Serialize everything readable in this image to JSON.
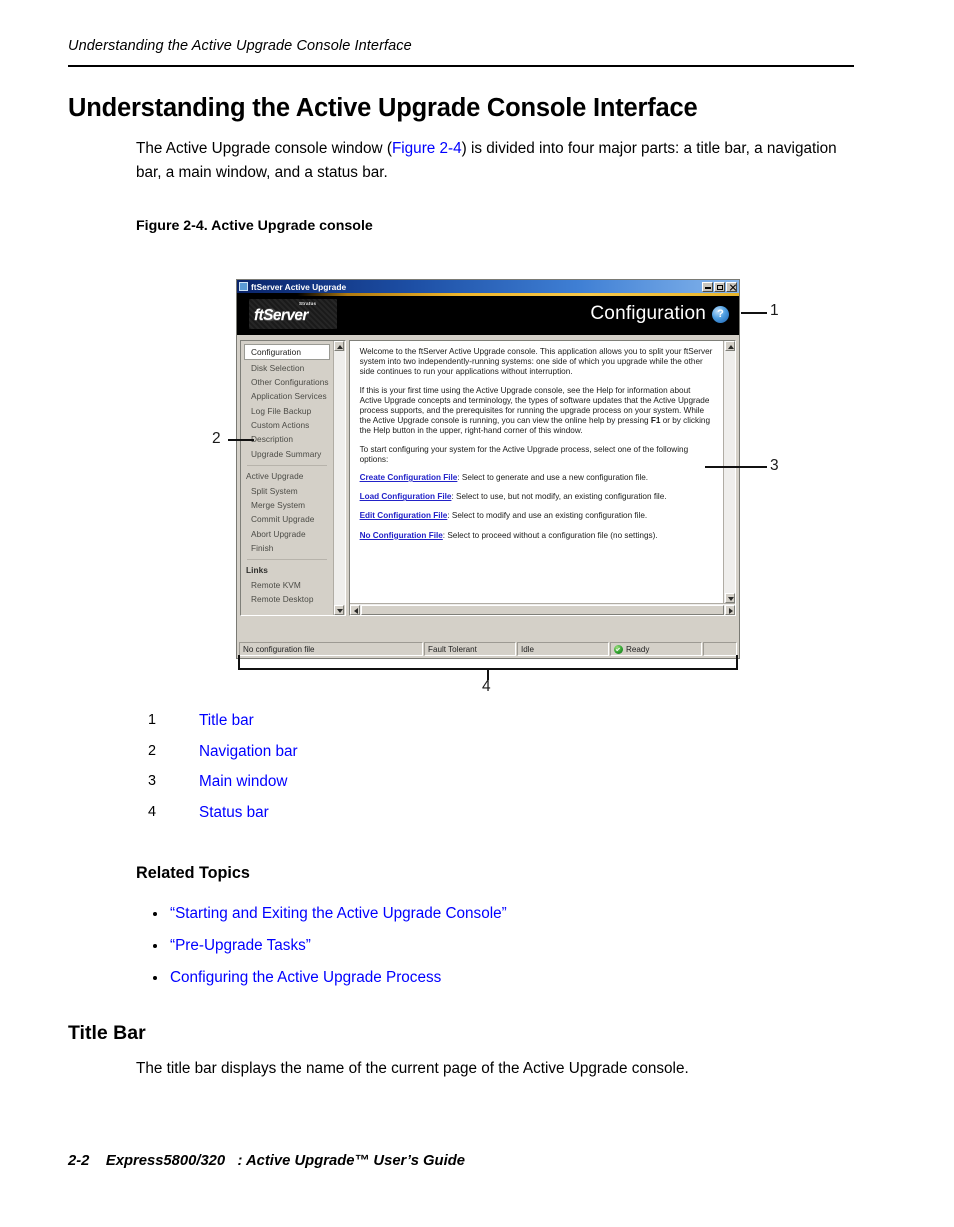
{
  "page": {
    "running_head": "Understanding the Active Upgrade Console Interface",
    "h1": "Understanding the Active Upgrade Console Interface",
    "intro_part1": "The Active Upgrade console window (",
    "intro_figure_link": "Figure 2-4",
    "intro_part2": ") is divided into four major parts: a title bar, a navigation bar, a main window, and a status bar.",
    "figure_caption": "Figure 2-4. Active Upgrade console",
    "related_heading": "Related Topics",
    "title_bar_heading": "Title Bar",
    "title_bar_para": "The title bar displays the name of the current page of the Active Upgrade console.",
    "footer_page": "2-2",
    "footer_text": "Express5800/320   : Active Upgrade™ User’s Guide",
    "link_color": "#0000ff"
  },
  "console": {
    "window_title": "ftServer Active Upgrade",
    "window_buttons": [
      "minimize",
      "maximize",
      "close"
    ],
    "brand": {
      "stratus": "Stratus",
      "ftserver": "ftServer",
      "page_title": "Configuration",
      "help_glyph": "?"
    },
    "nav": {
      "selected": "Configuration",
      "items": [
        {
          "label": "Configuration",
          "type": "selected"
        },
        {
          "label": "Disk Selection",
          "type": "item"
        },
        {
          "label": "Other Configurations",
          "type": "item"
        },
        {
          "label": "Application Services",
          "type": "item"
        },
        {
          "label": "Log File Backup",
          "type": "item"
        },
        {
          "label": "Custom Actions",
          "type": "item"
        },
        {
          "label": "Description",
          "type": "item"
        },
        {
          "label": "Upgrade Summary",
          "type": "item"
        },
        {
          "label": "Active Upgrade",
          "type": "group"
        },
        {
          "label": "Split System",
          "type": "item"
        },
        {
          "label": "Merge System",
          "type": "item"
        },
        {
          "label": "Commit Upgrade",
          "type": "item"
        },
        {
          "label": "Abort Upgrade",
          "type": "item"
        },
        {
          "label": "Finish",
          "type": "item"
        },
        {
          "label": "Links",
          "type": "links-head"
        },
        {
          "label": "Remote KVM",
          "type": "item"
        },
        {
          "label": "Remote Desktop",
          "type": "item"
        }
      ]
    },
    "main": {
      "para1": "Welcome to the ftServer Active Upgrade console.  This application allows you to split your ftServer system into two independently-running systems: one side of which you upgrade while the other side continues to run your applications without interruption.",
      "para2_a": "If this is your first time using the Active Upgrade console, see the Help for information about Active Upgrade concepts and terminology, the types of software updates that the Active Upgrade process supports, and the prerequisites for running the upgrade process on your system.  While the Active Upgrade console is running, you can view the online help by pressing ",
      "para2_key": "F1",
      "para2_b": " or by clicking the Help button in the upper, right-hand corner of this window.",
      "para3": "To start configuring your system for the Active Upgrade process, select one of the following options:",
      "options": [
        {
          "link": "Create Configuration File",
          "text": ": Select to generate and use a new configuration file."
        },
        {
          "link": "Load Configuration File",
          "text": ": Select to use, but not modify, an existing configuration file."
        },
        {
          "link": "Edit Configuration File",
          "text": ": Select to modify and use an existing configuration file."
        },
        {
          "link": "No Configuration File",
          "text": ": Select to proceed without a configuration file (no settings)."
        }
      ]
    },
    "status": {
      "cells": [
        "No configuration file",
        "Fault Tolerant",
        "Idle",
        "Ready",
        ""
      ],
      "ready_label": "Ready"
    }
  },
  "callouts": [
    {
      "num": "1"
    },
    {
      "num": "2"
    },
    {
      "num": "3"
    },
    {
      "num": "4"
    }
  ],
  "legend": [
    {
      "num": "1",
      "label": "Title bar"
    },
    {
      "num": "2",
      "label": "Navigation bar"
    },
    {
      "num": "3",
      "label": "Main window"
    },
    {
      "num": "4",
      "label": "Status bar"
    }
  ],
  "related_topics": [
    "“Starting and Exiting the Active Upgrade Console”",
    "“Pre-Upgrade Tasks”",
    "Configuring the Active Upgrade Process"
  ]
}
